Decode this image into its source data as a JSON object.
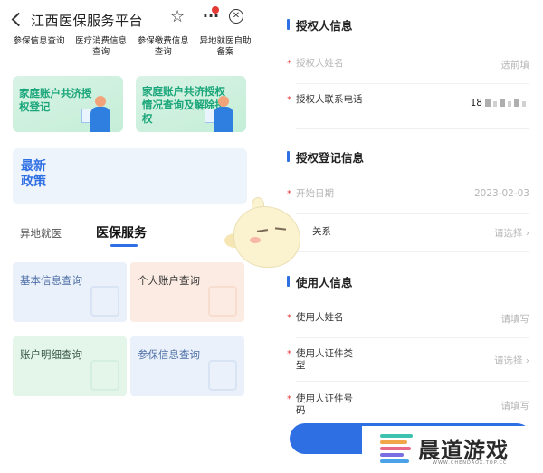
{
  "left": {
    "header": {
      "title": "江西医保服务平台",
      "back_glyph": "‹",
      "star_glyph": "☆",
      "more_glyph": "···",
      "close_glyph": "✕"
    },
    "quick_links": [
      {
        "label": "参保信息查询"
      },
      {
        "label": "医疗消费信息查询"
      },
      {
        "label": "参保缴费信息查询"
      },
      {
        "label": "异地就医自助备案"
      }
    ],
    "banners": [
      {
        "label": "家庭账户共济授权登记"
      },
      {
        "label": "家庭账户共济授权情况查询及解除授权"
      }
    ],
    "policy": {
      "label": "最新政策"
    },
    "tabs": [
      {
        "label": "异地就医"
      },
      {
        "label": "医保服务"
      }
    ],
    "services": [
      {
        "label": "基本信息查询"
      },
      {
        "label": "个人账户查询"
      },
      {
        "label": "账户明细查询"
      },
      {
        "label": "参保信息查询"
      }
    ]
  },
  "right": {
    "sections": [
      {
        "title": "授权人信息",
        "fields": [
          {
            "label": "授权人姓名",
            "value": "选前填"
          },
          {
            "label": "授权人联系电话",
            "value": "18"
          }
        ]
      },
      {
        "title": "授权登记信息",
        "fields": [
          {
            "label": "开始日期",
            "value": "2023-02-03"
          },
          {
            "label": "关系",
            "value": "请选择 ›"
          }
        ]
      },
      {
        "title": "使用人信息",
        "fields": [
          {
            "label": "使用人姓名",
            "value": "请填写"
          },
          {
            "label": "使用人证件类型",
            "value": "请选择 ›"
          },
          {
            "label": "使用人证件号码",
            "value": "请填写"
          }
        ]
      }
    ],
    "required_mark": "*"
  },
  "watermark": {
    "brand": "晨道游戏",
    "url": "WWW.CHENDAOX.TOP.CC",
    "logo_colors": [
      "#3fc1b0",
      "#f2a64a",
      "#e86a8a",
      "#7a6fe0",
      "#4aa3e8"
    ]
  },
  "colors": {
    "accent": "#2f6fe4",
    "banner_text": "#1aa67a",
    "required": "#e53935"
  }
}
